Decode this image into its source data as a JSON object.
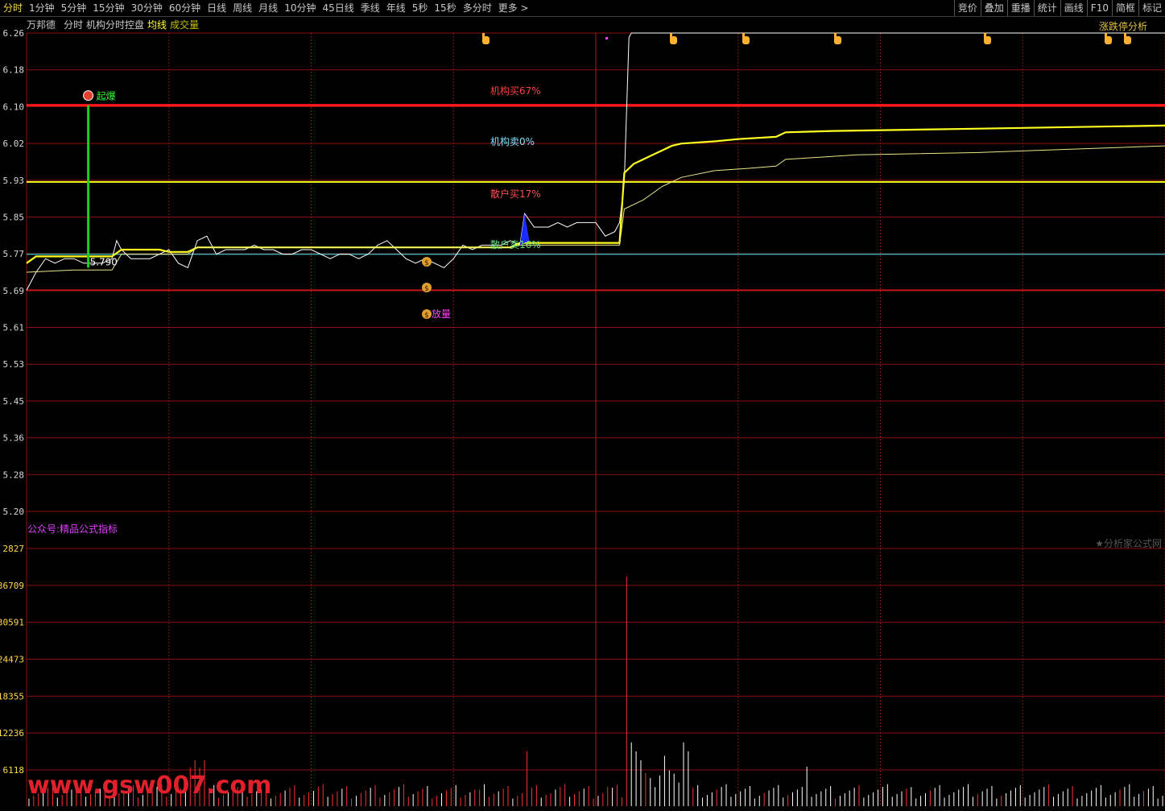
{
  "toolbar": {
    "tabs": [
      "分时",
      "1分钟",
      "5分钟",
      "15分钟",
      "30分钟",
      "60分钟",
      "日线",
      "周线",
      "月线",
      "10分钟",
      "45日线",
      "季线",
      "年线",
      "5秒",
      "15秒",
      "多分时",
      "更多 >"
    ],
    "active_tab": 0,
    "right_buttons": [
      "竞价",
      "叠加",
      "重播",
      "统计",
      "画线",
      "F10",
      "简框",
      "标记"
    ]
  },
  "infobar": {
    "stock_name": "万邦德",
    "mode": "分时",
    "indicator": "机构分时控盘",
    "avg_line": "均线",
    "volume": "成交量"
  },
  "top_right_link": "涨跌停分析",
  "footer_star": "★分析家公式网",
  "public_account": "公众号:精品公式指标",
  "watermark": "www.gsw007.com",
  "colors": {
    "price_line": "#ffffff",
    "avg_line": "#ffff20",
    "grid": "#8a1010",
    "limit_line": "#ff1a1a",
    "prev_close_line": "#3fb0b0",
    "buy_line": "#ffff20",
    "breakout_marker": "#18d018",
    "volume_up": "#ff3030",
    "volume_down": "#ffffff"
  },
  "chart_data": {
    "type": "line",
    "price_axis": {
      "ticks": [
        "6.26",
        "6.18",
        "6.10",
        "6.02",
        "5.93",
        "5.85",
        "5.77",
        "5.69",
        "5.61",
        "5.53",
        "5.45",
        "5.36",
        "5.28",
        "5.20"
      ],
      "ylim": [
        5.2,
        6.26
      ]
    },
    "volume_axis": {
      "ticks": [
        "2827",
        "36709",
        "30591",
        "24473",
        "18355",
        "12236",
        "6118"
      ]
    },
    "reference_lines": [
      {
        "name": "limit",
        "value": 6.1
      },
      {
        "name": "level",
        "value": 5.93
      },
      {
        "name": "prev_close",
        "value": 5.77
      },
      {
        "name": "low",
        "value": 5.69
      }
    ],
    "series": [
      {
        "name": "price",
        "points": [
          [
            0,
            5.69
          ],
          [
            2,
            5.73
          ],
          [
            4,
            5.76
          ],
          [
            6,
            5.75
          ],
          [
            8,
            5.76
          ],
          [
            10,
            5.76
          ],
          [
            12,
            5.75
          ],
          [
            14,
            5.75
          ],
          [
            16,
            5.75
          ],
          [
            18,
            5.76
          ],
          [
            19,
            5.8
          ],
          [
            20,
            5.78
          ],
          [
            22,
            5.76
          ],
          [
            24,
            5.76
          ],
          [
            26,
            5.76
          ],
          [
            28,
            5.77
          ],
          [
            30,
            5.78
          ],
          [
            32,
            5.75
          ],
          [
            34,
            5.74
          ],
          [
            36,
            5.8
          ],
          [
            38,
            5.81
          ],
          [
            40,
            5.77
          ],
          [
            42,
            5.78
          ],
          [
            44,
            5.78
          ],
          [
            46,
            5.78
          ],
          [
            48,
            5.79
          ],
          [
            50,
            5.78
          ],
          [
            52,
            5.78
          ],
          [
            54,
            5.77
          ],
          [
            56,
            5.77
          ],
          [
            58,
            5.78
          ],
          [
            60,
            5.78
          ],
          [
            62,
            5.77
          ],
          [
            64,
            5.76
          ],
          [
            66,
            5.77
          ],
          [
            68,
            5.77
          ],
          [
            70,
            5.76
          ],
          [
            72,
            5.77
          ],
          [
            74,
            5.79
          ],
          [
            76,
            5.8
          ],
          [
            78,
            5.78
          ],
          [
            80,
            5.76
          ],
          [
            82,
            5.75
          ],
          [
            84,
            5.76
          ],
          [
            86,
            5.75
          ],
          [
            88,
            5.74
          ],
          [
            90,
            5.76
          ],
          [
            92,
            5.79
          ],
          [
            94,
            5.78
          ],
          [
            96,
            5.79
          ],
          [
            98,
            5.79
          ],
          [
            100,
            5.79
          ],
          [
            102,
            5.8
          ],
          [
            104,
            5.79
          ],
          [
            105,
            5.86
          ],
          [
            107,
            5.83
          ],
          [
            110,
            5.83
          ],
          [
            112,
            5.84
          ],
          [
            114,
            5.83
          ],
          [
            116,
            5.84
          ],
          [
            118,
            5.84
          ],
          [
            120,
            5.84
          ],
          [
            122,
            5.81
          ],
          [
            124,
            5.82
          ],
          [
            125,
            5.84
          ],
          [
            126,
            5.93
          ],
          [
            127,
            6.25
          ],
          [
            127.5,
            6.26
          ],
          [
            240,
            6.26
          ]
        ]
      },
      {
        "name": "avg_line",
        "points": [
          [
            0,
            5.75
          ],
          [
            2,
            5.765
          ],
          [
            10,
            5.765
          ],
          [
            18,
            5.765
          ],
          [
            20,
            5.78
          ],
          [
            28,
            5.78
          ],
          [
            30,
            5.775
          ],
          [
            34,
            5.775
          ],
          [
            36,
            5.785
          ],
          [
            60,
            5.785
          ],
          [
            80,
            5.785
          ],
          [
            102,
            5.785
          ],
          [
            104,
            5.795
          ],
          [
            120,
            5.795
          ],
          [
            125,
            5.795
          ],
          [
            126,
            5.95
          ],
          [
            128,
            5.97
          ],
          [
            130,
            5.98
          ],
          [
            132,
            5.99
          ],
          [
            134,
            6.0
          ],
          [
            136,
            6.01
          ],
          [
            138,
            6.015
          ],
          [
            145,
            6.02
          ],
          [
            150,
            6.025
          ],
          [
            158,
            6.03
          ],
          [
            160,
            6.04
          ],
          [
            170,
            6.043
          ],
          [
            200,
            6.048
          ],
          [
            240,
            6.055
          ]
        ]
      },
      {
        "name": "signal_line",
        "points": [
          [
            0,
            5.73
          ],
          [
            10,
            5.735
          ],
          [
            18,
            5.735
          ],
          [
            20,
            5.77
          ],
          [
            28,
            5.77
          ],
          [
            30,
            5.77
          ],
          [
            34,
            5.77
          ],
          [
            36,
            5.785
          ],
          [
            60,
            5.785
          ],
          [
            102,
            5.785
          ],
          [
            104,
            5.79
          ],
          [
            125,
            5.79
          ],
          [
            126,
            5.87
          ],
          [
            130,
            5.89
          ],
          [
            134,
            5.92
          ],
          [
            138,
            5.94
          ],
          [
            145,
            5.955
          ],
          [
            152,
            5.96
          ],
          [
            158,
            5.965
          ],
          [
            160,
            5.98
          ],
          [
            175,
            5.99
          ],
          [
            200,
            5.995
          ],
          [
            240,
            6.01
          ]
        ]
      }
    ],
    "annotations": [
      {
        "text": "起爆",
        "minute": 13
      },
      {
        "text": "5.790",
        "minute": 13
      },
      {
        "text": "机构买67%"
      },
      {
        "text": "机构卖0%"
      },
      {
        "text": "散户买17%"
      },
      {
        "text": "散户卖16%"
      },
      {
        "text": "放量"
      }
    ]
  }
}
